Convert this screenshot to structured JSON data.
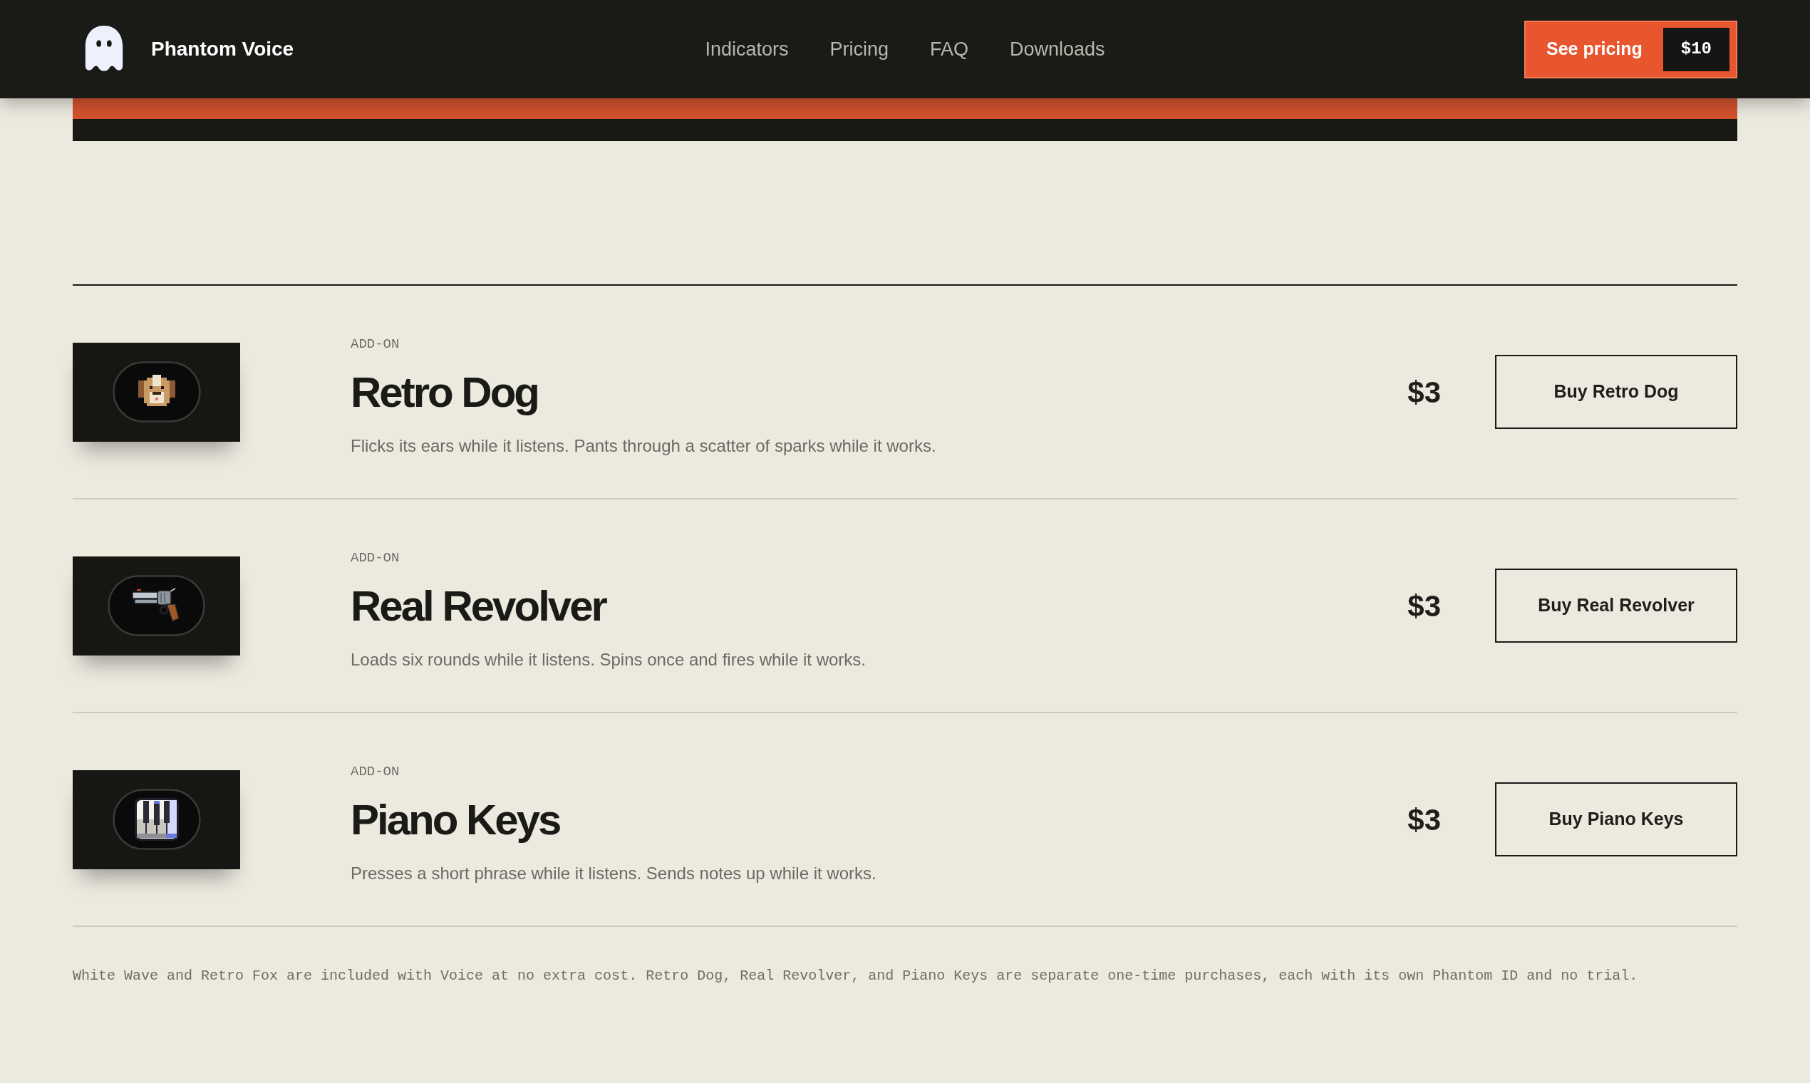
{
  "header": {
    "brand": "Phantom Voice",
    "nav": [
      "Indicators",
      "Pricing",
      "FAQ",
      "Downloads"
    ],
    "cta": {
      "label": "See pricing",
      "price": "$10"
    }
  },
  "addons": [
    {
      "kind": "dog",
      "tag": "ADD-ON",
      "title": "Retro Dog",
      "description": "Flicks its ears while it listens. Pants through a scatter of sparks while it works.",
      "price": "$3",
      "button": "Buy Retro Dog"
    },
    {
      "kind": "revolver",
      "tag": "ADD-ON",
      "title": "Real Revolver",
      "description": "Loads six rounds while it listens. Spins once and fires while it works.",
      "price": "$3",
      "button": "Buy Real Revolver"
    },
    {
      "kind": "piano",
      "tag": "ADD-ON",
      "title": "Piano Keys",
      "description": "Presses a short phrase while it listens. Sends notes up while it works.",
      "price": "$3",
      "button": "Buy Piano Keys"
    }
  ],
  "footnote": "White Wave and Retro Fox are included with Voice at no extra cost. Retro Dog, Real Revolver, and Piano Keys are separate one-time purchases, each with its own Phantom ID and no trial."
}
